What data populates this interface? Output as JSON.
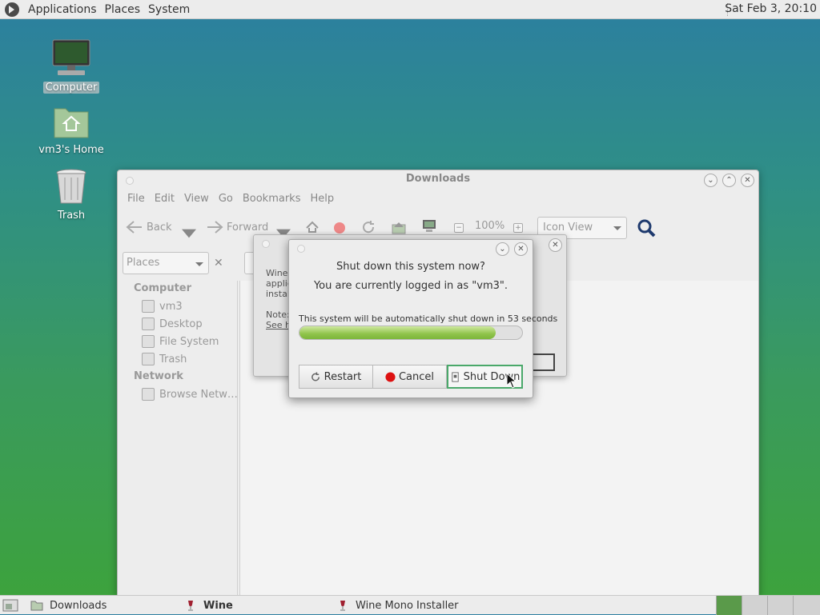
{
  "top_panel": {
    "menus": [
      "Applications",
      "Places",
      "System"
    ],
    "clock": "Sat Feb  3, 20:10"
  },
  "desktop_icons": [
    {
      "label": "Computer",
      "icon": "computer-icon"
    },
    {
      "label": "vm3's Home",
      "icon": "home-folder-icon"
    },
    {
      "label": "Trash",
      "icon": "trash-icon"
    }
  ],
  "file_manager": {
    "title": "Downloads",
    "menus": [
      "File",
      "Edit",
      "View",
      "Go",
      "Bookmarks",
      "Help"
    ],
    "toolbar": {
      "back": "Back",
      "forward": "Forward",
      "zoom": "100%",
      "view_mode": "Icon View"
    },
    "places_label": "Places",
    "sidebar": {
      "computer_heading": "Computer",
      "computer_items": [
        "vm3",
        "Desktop",
        "File System",
        "Trash"
      ],
      "network_heading": "Network",
      "network_items": [
        "Browse Netw…"
      ]
    }
  },
  "wine_dialog": {
    "lines": [
      "Wine",
      "applic",
      "instal",
      "",
      "Note:",
      "See h"
    ]
  },
  "shutdown_dialog": {
    "title": "Shut down this system now?",
    "message": "You are currently logged in as \"vm3\".",
    "countdown": "This system will be automatically shut down in 53 seconds",
    "progress": 0.88,
    "buttons": {
      "restart": "Restart",
      "cancel": "Cancel",
      "shutdown": "Shut Down"
    }
  },
  "bottom_panel": {
    "tasks": [
      "Downloads",
      "Wine",
      "Wine Mono Installer"
    ]
  },
  "colors": {
    "progress_fill": "#8fc34a",
    "active_workspace": "#5a9a4a",
    "cancel_red": "#dd1111"
  }
}
